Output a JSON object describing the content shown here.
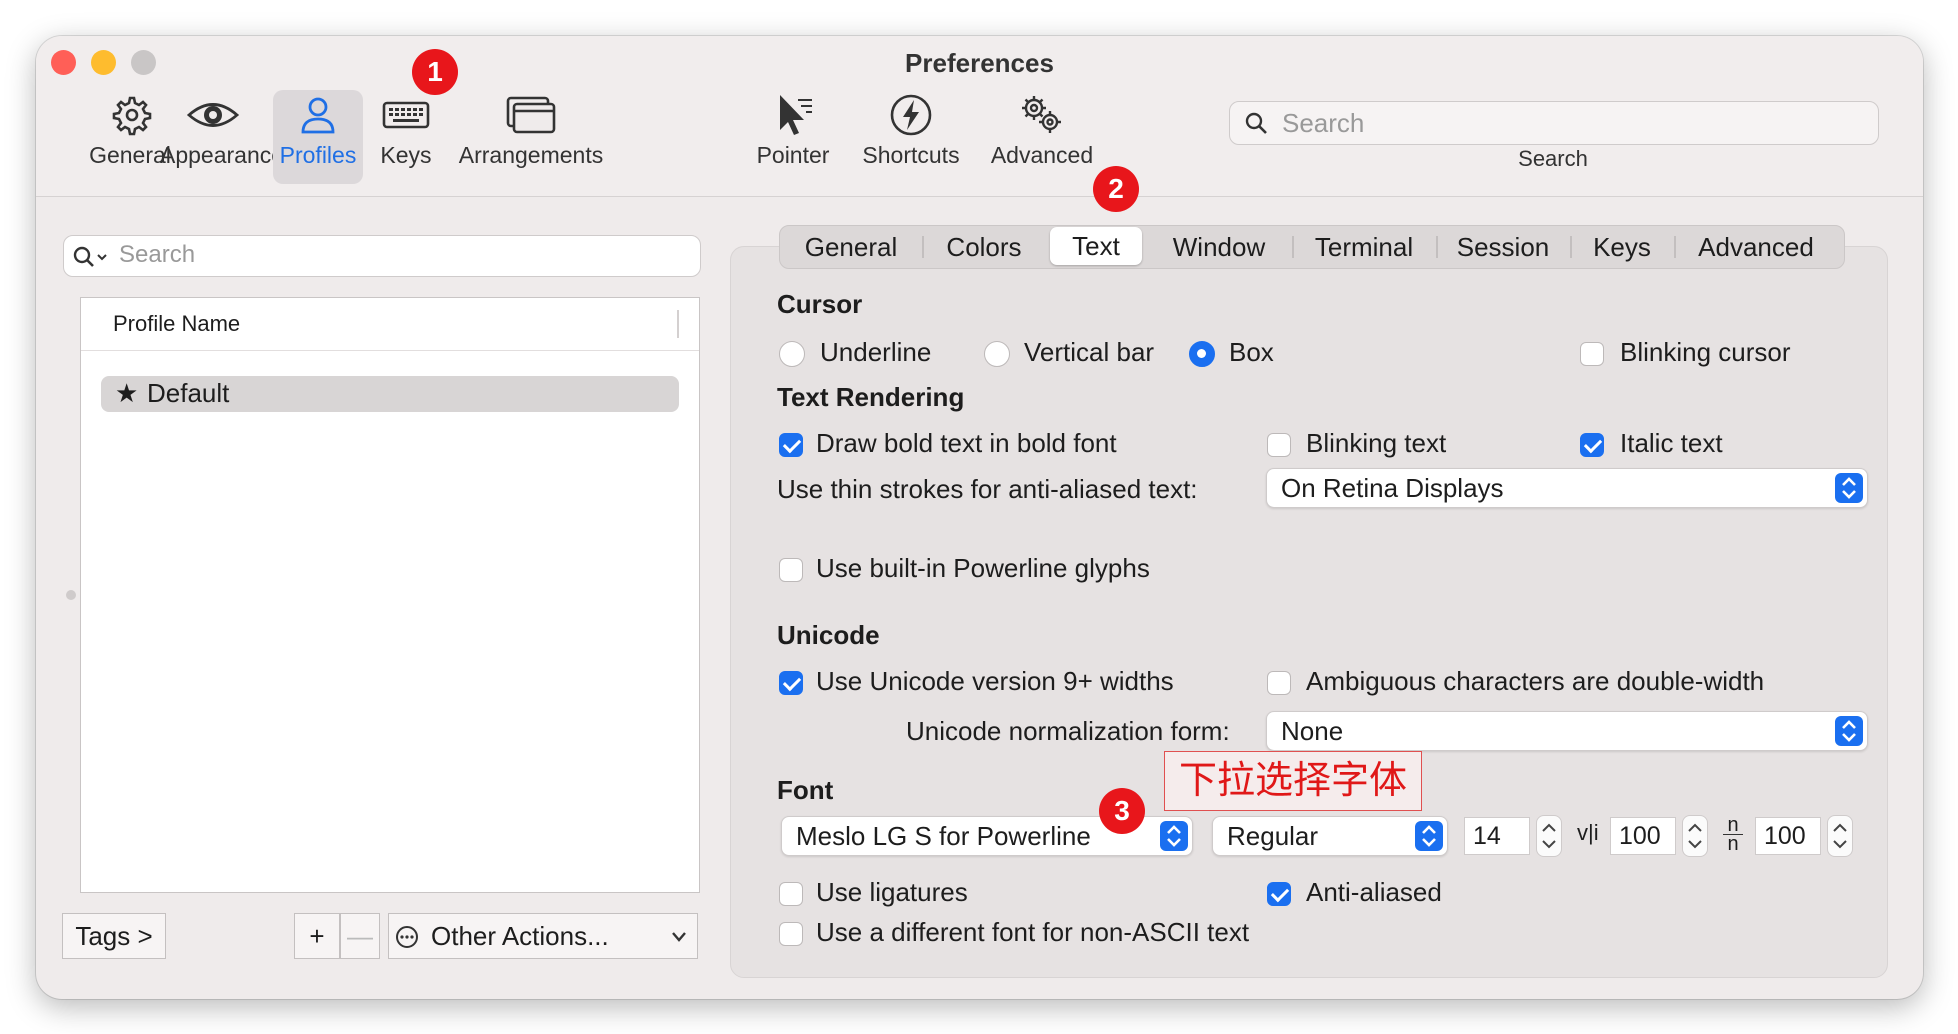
{
  "window": {
    "title": "Preferences"
  },
  "toolbar": {
    "items": [
      {
        "label": "General",
        "icon": "gear-icon"
      },
      {
        "label": "Appearance",
        "icon": "eye-icon"
      },
      {
        "label": "Profiles",
        "icon": "person-icon",
        "selected": true
      },
      {
        "label": "Keys",
        "icon": "keyboard-icon"
      },
      {
        "label": "Arrangements",
        "icon": "window-stack-icon"
      },
      {
        "label": "Pointer",
        "icon": "cursor-icon"
      },
      {
        "label": "Shortcuts",
        "icon": "bolt-icon"
      },
      {
        "label": "Advanced",
        "icon": "gears-icon"
      }
    ],
    "search_placeholder": "Search",
    "search_caption": "Search"
  },
  "annotations": {
    "badge1": "1",
    "badge2": "2",
    "badge3": "3",
    "callout": "下拉选择字体"
  },
  "profiles": {
    "search_placeholder": "Search",
    "column_header": "Profile Name",
    "items": [
      {
        "name": "Default",
        "selected": true
      }
    ],
    "tags_button": "Tags >",
    "add_label": "+",
    "remove_label": "—",
    "other_actions": "Other Actions..."
  },
  "tabs": {
    "items": [
      "General",
      "Colors",
      "Text",
      "Window",
      "Terminal",
      "Session",
      "Keys",
      "Advanced"
    ],
    "selected": "Text"
  },
  "cursor": {
    "heading": "Cursor",
    "underline": "Underline",
    "vertical_bar": "Vertical bar",
    "box": "Box",
    "selected": "Box",
    "blinking_label": "Blinking cursor",
    "blinking_checked": false
  },
  "rendering": {
    "heading": "Text Rendering",
    "bold_label": "Draw bold text in bold font",
    "bold_checked": true,
    "blink_label": "Blinking text",
    "blink_checked": false,
    "italic_label": "Italic text",
    "italic_checked": true,
    "thin_label": "Use thin strokes for anti-aliased text:",
    "thin_value": "On Retina Displays",
    "powerline_label": "Use built-in Powerline glyphs",
    "powerline_checked": false
  },
  "unicode": {
    "heading": "Unicode",
    "v9_label": "Use Unicode version 9+ widths",
    "v9_checked": true,
    "ambiguous_label": "Ambiguous characters are double-width",
    "ambiguous_checked": false,
    "norm_label": "Unicode normalization form:",
    "norm_value": "None"
  },
  "font": {
    "heading": "Font",
    "family": "Meslo LG S for Powerline",
    "style": "Regular",
    "size": "14",
    "vl_glyph": "v|i",
    "hspacing": "100",
    "nn_glyph": "n/n",
    "vspacing": "100",
    "ligatures_label": "Use ligatures",
    "ligatures_checked": false,
    "antialias_label": "Anti-aliased",
    "antialias_checked": true,
    "nonascii_label": "Use a different font for non-ASCII text",
    "nonascii_checked": false
  },
  "colors": {
    "accent": "#1a6ff0",
    "badge": "#e8161b",
    "close": "#ff5f57",
    "minimize": "#febc2e",
    "zoom": "#c9c6c6"
  }
}
